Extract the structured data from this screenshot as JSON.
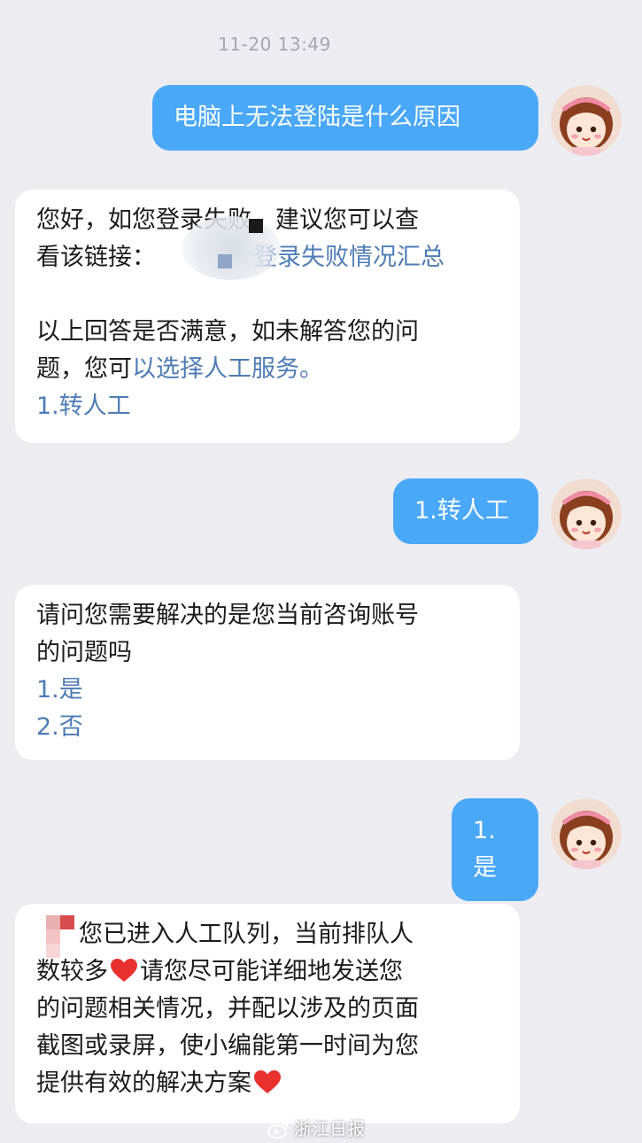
{
  "chat": {
    "timestamp": "11-20 13:49",
    "messages": [
      {
        "from": "user",
        "text": "电脑上无法登陆是什么原因"
      },
      {
        "from": "bot",
        "line1": "您好，如您登录失败，建议您可以查",
        "line2_prefix": "看该链接：",
        "line2_link": "登录失败情况汇总",
        "line3": "以上回答是否满意，如未解答您的问",
        "line4_prefix": "题，您可",
        "line4_link": "以选择人工服务。",
        "option1": "1.转人工"
      },
      {
        "from": "user",
        "text": "1.转人工"
      },
      {
        "from": "bot",
        "line1": "请问您需要解决的是您当前咨询账号",
        "line2": "的问题吗",
        "option1": "1.是",
        "option2": "2.否"
      },
      {
        "from": "user",
        "text": "1.是"
      },
      {
        "from": "bot",
        "line1": "您已进入人工队列，当前排队人",
        "line2": "数较多",
        "line2_rest": "请您尽可能详细地发送您",
        "line3": "的问题相关情况，并配以涉及的页面",
        "line4": "截图或录屏，使小编能第一时间为您",
        "line5": "提供有效的解决方案"
      }
    ]
  },
  "watermark": {
    "text": "浙江日报"
  },
  "colors": {
    "user_bubble": "#4aa8f8",
    "bot_bubble": "#ffffff",
    "link": "#4d7cb5",
    "heart": "#e8312e",
    "background": "#ececf1"
  },
  "icons": {
    "avatar": "cartoon-girl-avatar-icon",
    "heart": "heart-icon",
    "watermark": "weibo-icon"
  }
}
